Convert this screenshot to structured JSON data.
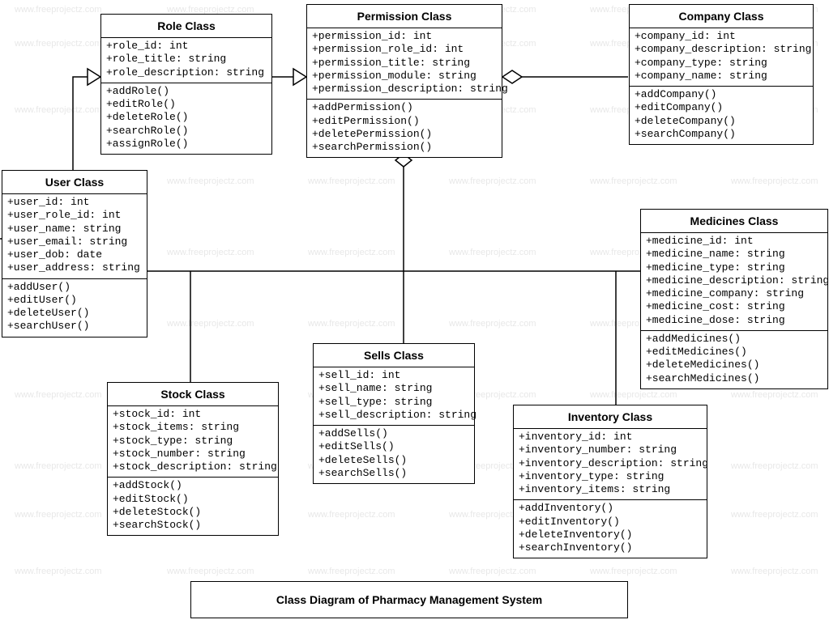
{
  "diagram_title": "Class Diagram of Pharmacy Management System",
  "watermark_text": "www.freeprojectz.com",
  "classes": {
    "role": {
      "title": "Role Class",
      "attrs": [
        "+role_id: int",
        "+role_title: string",
        "+role_description: string"
      ],
      "ops": [
        "+addRole()",
        "+editRole()",
        "+deleteRole()",
        "+searchRole()",
        "+assignRole()"
      ]
    },
    "permission": {
      "title": "Permission Class",
      "attrs": [
        "+permission_id: int",
        "+permission_role_id: int",
        "+permission_title: string",
        "+permission_module: string",
        "+permission_description: string"
      ],
      "ops": [
        "+addPermission()",
        "+editPermission()",
        "+deletePermission()",
        "+searchPermission()"
      ]
    },
    "company": {
      "title": "Company Class",
      "attrs": [
        "+company_id: int",
        "+company_description: string",
        "+company_type: string",
        "+company_name: string"
      ],
      "ops": [
        "+addCompany()",
        "+editCompany()",
        "+deleteCompany()",
        "+searchCompany()"
      ]
    },
    "user": {
      "title": "User Class",
      "attrs": [
        "+user_id: int",
        "+user_role_id: int",
        "+user_name: string",
        "+user_email: string",
        "+user_dob: date",
        "+user_address: string"
      ],
      "ops": [
        "+addUser()",
        "+editUser()",
        "+deleteUser()",
        "+searchUser()"
      ]
    },
    "medicines": {
      "title": "Medicines Class",
      "attrs": [
        "+medicine_id: int",
        "+medicine_name: string",
        "+medicine_type: string",
        "+medicine_description: string",
        "+medicine_company: string",
        "+medicine_cost: string",
        "+medicine_dose: string"
      ],
      "ops": [
        "+addMedicines()",
        "+editMedicines()",
        "+deleteMedicines()",
        "+searchMedicines()"
      ]
    },
    "stock": {
      "title": "Stock Class",
      "attrs": [
        "+stock_id: int",
        "+stock_items: string",
        "+stock_type: string",
        "+stock_number: string",
        "+stock_description: string"
      ],
      "ops": [
        "+addStock()",
        "+editStock()",
        "+deleteStock()",
        "+searchStock()"
      ]
    },
    "sells": {
      "title": "Sells Class",
      "attrs": [
        "+sell_id: int",
        "+sell_name: string",
        "+sell_type: string",
        "+sell_description: string"
      ],
      "ops": [
        "+addSells()",
        "+editSells()",
        "+deleteSells()",
        "+searchSells()"
      ]
    },
    "inventory": {
      "title": "Inventory Class",
      "attrs": [
        "+inventory_id: int",
        "+inventory_number: string",
        "+inventory_description: string",
        "+inventory_type: string",
        "+inventory_items: string"
      ],
      "ops": [
        "+addInventory()",
        "+editInventory()",
        "+deleteInventory()",
        "+searchInventory()"
      ]
    }
  }
}
